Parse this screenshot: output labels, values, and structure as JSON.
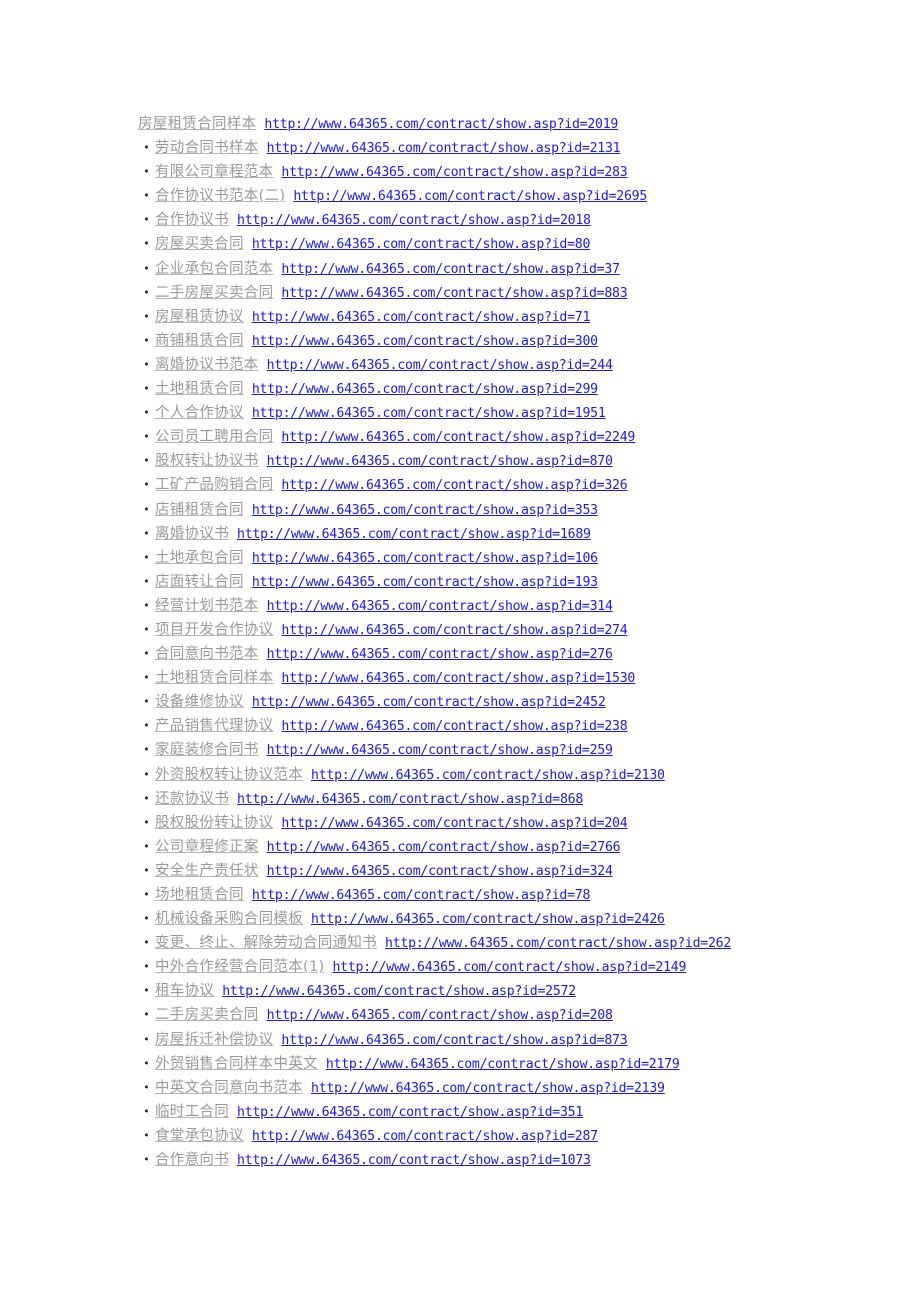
{
  "colors": {
    "title_link": "#9a9a9a",
    "url_link": "#1a1aee",
    "background": "#ffffff"
  },
  "bullet_glyph": "•",
  "items": [
    {
      "title": "房屋租赁合同样本",
      "url": "http://www.64365.com/contract/show.asp?id=2019"
    },
    {
      "title": "劳动合同书样本",
      "url": "http://www.64365.com/contract/show.asp?id=2131"
    },
    {
      "title": "有限公司章程范本",
      "url": "http://www.64365.com/contract/show.asp?id=283"
    },
    {
      "title": "合作协议书范本(二)",
      "url": "http://www.64365.com/contract/show.asp?id=2695"
    },
    {
      "title": "合作协议书",
      "url": "http://www.64365.com/contract/show.asp?id=2018"
    },
    {
      "title": "房屋买卖合同",
      "url": "http://www.64365.com/contract/show.asp?id=80"
    },
    {
      "title": "企业承包合同范本",
      "url": "http://www.64365.com/contract/show.asp?id=37"
    },
    {
      "title": "二手房屋买卖合同",
      "url": "http://www.64365.com/contract/show.asp?id=883"
    },
    {
      "title": "房屋租赁协议",
      "url": "http://www.64365.com/contract/show.asp?id=71"
    },
    {
      "title": "商铺租赁合同",
      "url": "http://www.64365.com/contract/show.asp?id=300"
    },
    {
      "title": "离婚协议书范本",
      "url": "http://www.64365.com/contract/show.asp?id=244"
    },
    {
      "title": "土地租赁合同",
      "url": "http://www.64365.com/contract/show.asp?id=299"
    },
    {
      "title": "个人合作协议",
      "url": "http://www.64365.com/contract/show.asp?id=1951"
    },
    {
      "title": "公司员工聘用合同",
      "url": "http://www.64365.com/contract/show.asp?id=2249"
    },
    {
      "title": "股权转让协议书",
      "url": "http://www.64365.com/contract/show.asp?id=870"
    },
    {
      "title": "工矿产品购销合同",
      "url": "http://www.64365.com/contract/show.asp?id=326"
    },
    {
      "title": "店铺租赁合同",
      "url": "http://www.64365.com/contract/show.asp?id=353"
    },
    {
      "title": "离婚协议书",
      "url": "http://www.64365.com/contract/show.asp?id=1689"
    },
    {
      "title": "土地承包合同",
      "url": "http://www.64365.com/contract/show.asp?id=106"
    },
    {
      "title": "店面转让合同",
      "url": "http://www.64365.com/contract/show.asp?id=193"
    },
    {
      "title": "经营计划书范本",
      "url": "http://www.64365.com/contract/show.asp?id=314"
    },
    {
      "title": "项目开发合作协议",
      "url": "http://www.64365.com/contract/show.asp?id=274"
    },
    {
      "title": "合同意向书范本",
      "url": "http://www.64365.com/contract/show.asp?id=276"
    },
    {
      "title": "土地租赁合同样本",
      "url": "http://www.64365.com/contract/show.asp?id=1530"
    },
    {
      "title": "设备维修协议",
      "url": "http://www.64365.com/contract/show.asp?id=2452"
    },
    {
      "title": "产品销售代理协议",
      "url": "http://www.64365.com/contract/show.asp?id=238"
    },
    {
      "title": "家庭装修合同书",
      "url": "http://www.64365.com/contract/show.asp?id=259"
    },
    {
      "title": "外资股权转让协议范本",
      "url": "http://www.64365.com/contract/show.asp?id=2130"
    },
    {
      "title": "还款协议书",
      "url": "http://www.64365.com/contract/show.asp?id=868"
    },
    {
      "title": "股权股份转让协议",
      "url": "http://www.64365.com/contract/show.asp?id=204"
    },
    {
      "title": "公司章程修正案",
      "url": "http://www.64365.com/contract/show.asp?id=2766"
    },
    {
      "title": "安全生产责任状",
      "url": "http://www.64365.com/contract/show.asp?id=324"
    },
    {
      "title": "场地租赁合同",
      "url": "http://www.64365.com/contract/show.asp?id=78"
    },
    {
      "title": "机械设备采购合同模板",
      "url": "http://www.64365.com/contract/show.asp?id=2426"
    },
    {
      "title": "变更、终止、解除劳动合同通知书",
      "url": "http://www.64365.com/contract/show.asp?id=262"
    },
    {
      "title": "中外合作经营合同范本(1)",
      "url": "http://www.64365.com/contract/show.asp?id=2149"
    },
    {
      "title": "租车协议",
      "url": "http://www.64365.com/contract/show.asp?id=2572"
    },
    {
      "title": "二手房买卖合同",
      "url": "http://www.64365.com/contract/show.asp?id=208"
    },
    {
      "title": "房屋拆迁补偿协议",
      "url": "http://www.64365.com/contract/show.asp?id=873"
    },
    {
      "title": "外贸销售合同样本中英文",
      "url": "http://www.64365.com/contract/show.asp?id=2179"
    },
    {
      "title": "中英文合同意向书范本",
      "url": "http://www.64365.com/contract/show.asp?id=2139"
    },
    {
      "title": "临时工合同",
      "url": "http://www.64365.com/contract/show.asp?id=351"
    },
    {
      "title": "食堂承包协议",
      "url": "http://www.64365.com/contract/show.asp?id=287"
    },
    {
      "title": "合作意向书",
      "url": "http://www.64365.com/contract/show.asp?id=1073"
    }
  ]
}
